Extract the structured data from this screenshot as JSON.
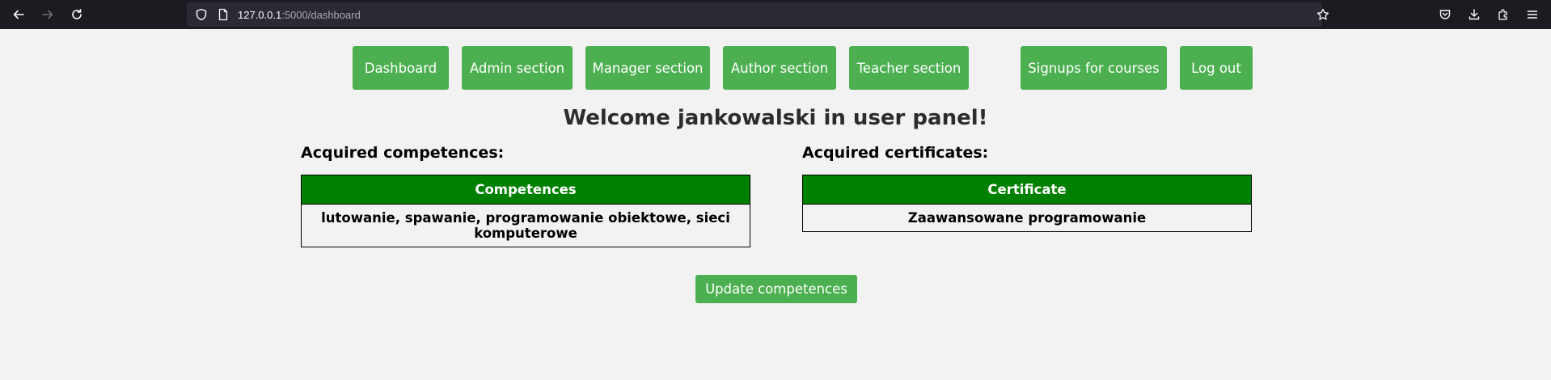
{
  "browser": {
    "url_host": "127.0.0.1",
    "url_path": ":5000/dashboard"
  },
  "nav": {
    "dashboard": "Dashboard",
    "admin": "Admin section",
    "manager": "Manager section",
    "author": "Author section",
    "teacher": "Teacher section",
    "signups": "Signups for courses",
    "logout": "Log out"
  },
  "welcome": "Welcome jankowalski in user panel!",
  "competences": {
    "title": "Acquired competences:",
    "header": "Competences",
    "value": "lutowanie, spawanie, programowanie obiektowe, sieci komputerowe"
  },
  "certificates": {
    "title": "Acquired certificates:",
    "header": "Certificate",
    "value": "Zaawansowane programowanie"
  },
  "update_button": "Update competences",
  "colors": {
    "button": "#4caf50",
    "table_header": "#008000",
    "background": "#f2f2f2"
  }
}
